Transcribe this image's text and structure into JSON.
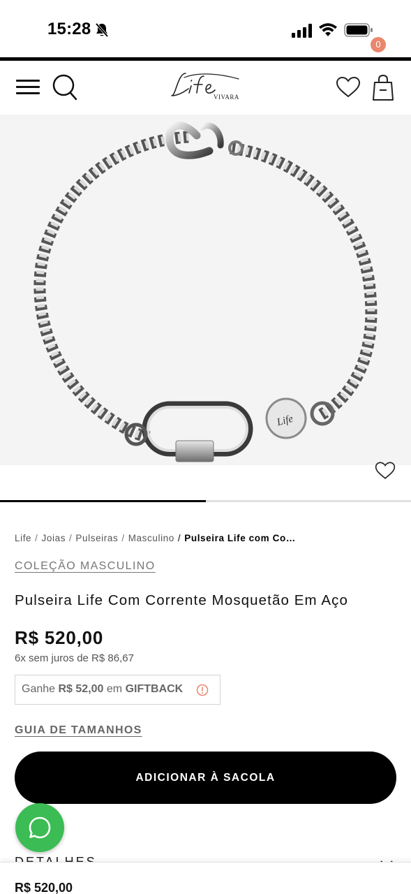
{
  "status_bar": {
    "time": "15:28"
  },
  "header": {
    "logo_text": "Life",
    "logo_subtext": "VIVARA",
    "bag_count": "0"
  },
  "gallery": {
    "image": "silver-box-chain-bracelet-with-carabiner",
    "slide_progress": 0.5,
    "coin_text": "Life"
  },
  "breadcrumb": {
    "items": [
      "Life",
      "Joias",
      "Pulseiras",
      "Masculino"
    ],
    "current": "Pulseira Life com Co…"
  },
  "product": {
    "collection": "COLEÇÃO MASCULINO",
    "title": "Pulseira Life Com Corrente Mosquetão Em Aço",
    "price": "R$ 520,00",
    "installments": "6x sem juros de R$ 86,67",
    "giftback": {
      "prefix": "Ganhe",
      "amount": "R$ 52,00",
      "middle": "em",
      "label": "GIFTBACK"
    },
    "size_guide": "GUIA DE TAMANHOS",
    "add_to_bag": "ADICIONAR À SACOLA",
    "details": "DETALHES"
  },
  "sticky_bar": {
    "price": "R$ 520,00"
  },
  "colors": {
    "accent": "#000000",
    "badge": "#e9876e",
    "whatsapp": "#3cbc54",
    "gallery_bg": "#f4f4f4"
  }
}
